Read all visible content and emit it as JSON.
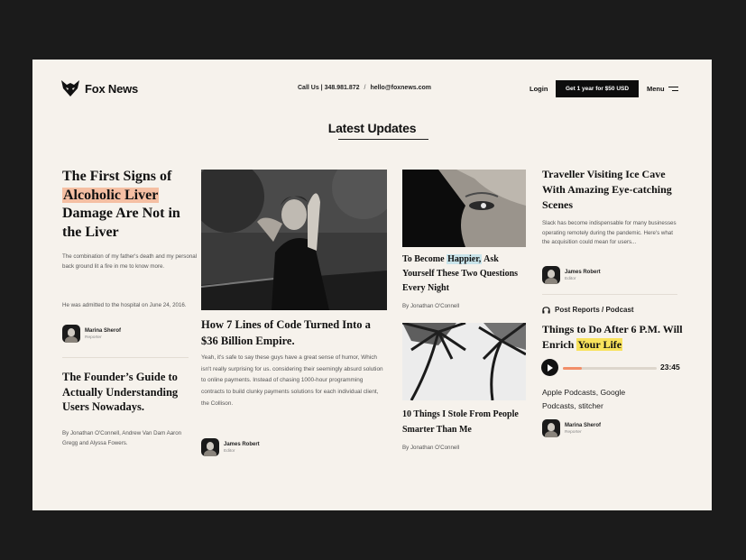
{
  "header": {
    "brand": "Fox News",
    "call_label": "Call Us",
    "phone": "348.981.872",
    "separator": "/",
    "email": "hello@foxnews.com",
    "login": "Login",
    "cta": "Get 1 year for $50 USD",
    "menu": "Menu"
  },
  "section_title": "Latest Updates",
  "col1": {
    "article1": {
      "title_pre": "The First Signs of",
      "title_highlight": "Alcoholic Liver",
      "title_post": "Damage Are Not in the Liver",
      "p1": "The combination of my father's death and my personal back ground lit a fire in me to know more.",
      "p2": "He was admitted to the hospital on June 24, 2016.",
      "author_name": "Marina Sherof",
      "author_role": "Reporter"
    },
    "article2": {
      "title": "The Founder’s Guide to Actually Understanding Users Nowadays.",
      "byline": "By Jonathan O'Connell, Andrew Van Dam Aaron Gregg and Alyssa Fowers."
    }
  },
  "col2": {
    "title": "How 7 Lines of Code Turned Into a $36 Billion Empire.",
    "paragraph": "Yeah, it's safe to say these guys have a great sense of humor, Which isn't really surprising for us. considering their seemingly absurd solution to online payments. Instead of chasing 1000-hour programming contracts to build clunky payments solutions for each individual client, the Collison.",
    "author_name": "James Robert",
    "author_role": "Editor"
  },
  "col3": {
    "article1": {
      "title_pre": "To Become",
      "title_highlight": "Happier,",
      "title_post": "Ask Yourself These Two Questions Every Night",
      "byline": "By Jonathan O'Connell"
    },
    "article2": {
      "title": "10 Things I Stole From People Smarter Than Me",
      "byline": "By Jonathan O'Connell"
    }
  },
  "col4": {
    "article1": {
      "title": "Traveller Visiting Ice Cave With Amazing Eye-catching Scenes",
      "paragraph": "Slack has become indispensable for many businesses operating remotely during the pandemic. Here's what the acquisition could mean for users...",
      "author_name": "James Robert",
      "author_role": "Editor"
    },
    "podcast": {
      "label": "Post Reports / Podcast",
      "title_pre": "Things to Do After 6 P.M. Will Enrich",
      "title_highlight": "Your Life",
      "progress": 0.2,
      "time": "23:45",
      "platforms": "Apple Podcasts, Google Podcasts, stitcher",
      "author_name": "Marina Sherof",
      "author_role": "Reporter"
    }
  },
  "colors": {
    "page_bg": "#f6f2ec",
    "frame_bg": "#1b1b1b",
    "highlight_orange": "#f5bfa3",
    "highlight_blue": "#c9e4ea",
    "highlight_yellow": "#f8e25c",
    "progress": "#f28e68"
  },
  "icons": [
    "fox-logo-icon",
    "menu-icon",
    "headphones-icon",
    "play-icon"
  ]
}
